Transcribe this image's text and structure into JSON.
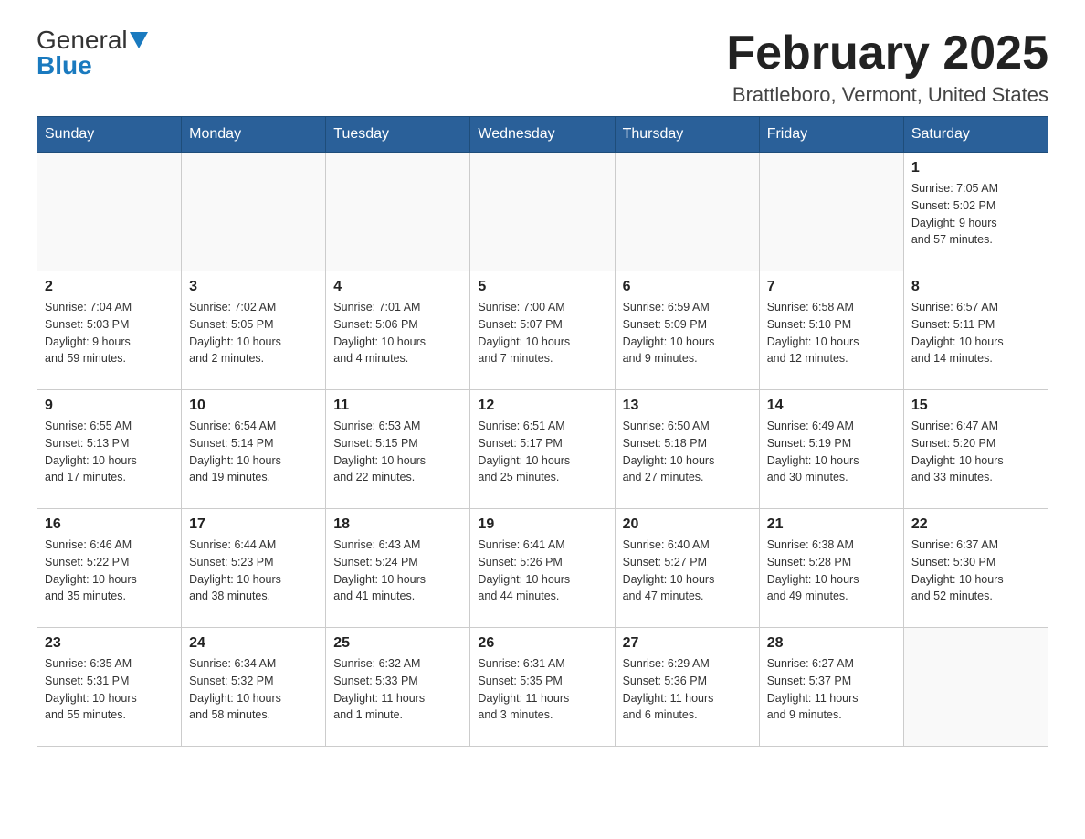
{
  "logo": {
    "general": "General",
    "blue": "Blue"
  },
  "header": {
    "title": "February 2025",
    "location": "Brattleboro, Vermont, United States"
  },
  "weekdays": [
    "Sunday",
    "Monday",
    "Tuesday",
    "Wednesday",
    "Thursday",
    "Friday",
    "Saturday"
  ],
  "weeks": [
    [
      {
        "day": "",
        "info": ""
      },
      {
        "day": "",
        "info": ""
      },
      {
        "day": "",
        "info": ""
      },
      {
        "day": "",
        "info": ""
      },
      {
        "day": "",
        "info": ""
      },
      {
        "day": "",
        "info": ""
      },
      {
        "day": "1",
        "info": "Sunrise: 7:05 AM\nSunset: 5:02 PM\nDaylight: 9 hours\nand 57 minutes."
      }
    ],
    [
      {
        "day": "2",
        "info": "Sunrise: 7:04 AM\nSunset: 5:03 PM\nDaylight: 9 hours\nand 59 minutes."
      },
      {
        "day": "3",
        "info": "Sunrise: 7:02 AM\nSunset: 5:05 PM\nDaylight: 10 hours\nand 2 minutes."
      },
      {
        "day": "4",
        "info": "Sunrise: 7:01 AM\nSunset: 5:06 PM\nDaylight: 10 hours\nand 4 minutes."
      },
      {
        "day": "5",
        "info": "Sunrise: 7:00 AM\nSunset: 5:07 PM\nDaylight: 10 hours\nand 7 minutes."
      },
      {
        "day": "6",
        "info": "Sunrise: 6:59 AM\nSunset: 5:09 PM\nDaylight: 10 hours\nand 9 minutes."
      },
      {
        "day": "7",
        "info": "Sunrise: 6:58 AM\nSunset: 5:10 PM\nDaylight: 10 hours\nand 12 minutes."
      },
      {
        "day": "8",
        "info": "Sunrise: 6:57 AM\nSunset: 5:11 PM\nDaylight: 10 hours\nand 14 minutes."
      }
    ],
    [
      {
        "day": "9",
        "info": "Sunrise: 6:55 AM\nSunset: 5:13 PM\nDaylight: 10 hours\nand 17 minutes."
      },
      {
        "day": "10",
        "info": "Sunrise: 6:54 AM\nSunset: 5:14 PM\nDaylight: 10 hours\nand 19 minutes."
      },
      {
        "day": "11",
        "info": "Sunrise: 6:53 AM\nSunset: 5:15 PM\nDaylight: 10 hours\nand 22 minutes."
      },
      {
        "day": "12",
        "info": "Sunrise: 6:51 AM\nSunset: 5:17 PM\nDaylight: 10 hours\nand 25 minutes."
      },
      {
        "day": "13",
        "info": "Sunrise: 6:50 AM\nSunset: 5:18 PM\nDaylight: 10 hours\nand 27 minutes."
      },
      {
        "day": "14",
        "info": "Sunrise: 6:49 AM\nSunset: 5:19 PM\nDaylight: 10 hours\nand 30 minutes."
      },
      {
        "day": "15",
        "info": "Sunrise: 6:47 AM\nSunset: 5:20 PM\nDaylight: 10 hours\nand 33 minutes."
      }
    ],
    [
      {
        "day": "16",
        "info": "Sunrise: 6:46 AM\nSunset: 5:22 PM\nDaylight: 10 hours\nand 35 minutes."
      },
      {
        "day": "17",
        "info": "Sunrise: 6:44 AM\nSunset: 5:23 PM\nDaylight: 10 hours\nand 38 minutes."
      },
      {
        "day": "18",
        "info": "Sunrise: 6:43 AM\nSunset: 5:24 PM\nDaylight: 10 hours\nand 41 minutes."
      },
      {
        "day": "19",
        "info": "Sunrise: 6:41 AM\nSunset: 5:26 PM\nDaylight: 10 hours\nand 44 minutes."
      },
      {
        "day": "20",
        "info": "Sunrise: 6:40 AM\nSunset: 5:27 PM\nDaylight: 10 hours\nand 47 minutes."
      },
      {
        "day": "21",
        "info": "Sunrise: 6:38 AM\nSunset: 5:28 PM\nDaylight: 10 hours\nand 49 minutes."
      },
      {
        "day": "22",
        "info": "Sunrise: 6:37 AM\nSunset: 5:30 PM\nDaylight: 10 hours\nand 52 minutes."
      }
    ],
    [
      {
        "day": "23",
        "info": "Sunrise: 6:35 AM\nSunset: 5:31 PM\nDaylight: 10 hours\nand 55 minutes."
      },
      {
        "day": "24",
        "info": "Sunrise: 6:34 AM\nSunset: 5:32 PM\nDaylight: 10 hours\nand 58 minutes."
      },
      {
        "day": "25",
        "info": "Sunrise: 6:32 AM\nSunset: 5:33 PM\nDaylight: 11 hours\nand 1 minute."
      },
      {
        "day": "26",
        "info": "Sunrise: 6:31 AM\nSunset: 5:35 PM\nDaylight: 11 hours\nand 3 minutes."
      },
      {
        "day": "27",
        "info": "Sunrise: 6:29 AM\nSunset: 5:36 PM\nDaylight: 11 hours\nand 6 minutes."
      },
      {
        "day": "28",
        "info": "Sunrise: 6:27 AM\nSunset: 5:37 PM\nDaylight: 11 hours\nand 9 minutes."
      },
      {
        "day": "",
        "info": ""
      }
    ]
  ]
}
